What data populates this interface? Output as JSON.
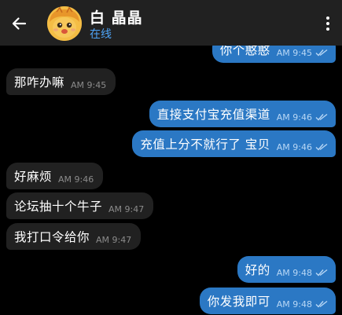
{
  "header": {
    "title": "白 晶晶",
    "status": "在线",
    "back_icon": "arrow-left-icon",
    "menu_icon": "more-vertical-icon",
    "status_color": "#4ea4f6"
  },
  "colors": {
    "incoming_bubble": "#212121",
    "outgoing_bubble": "#2b78c4",
    "background": "#000000"
  },
  "messages": [
    {
      "text": "你个憨憨",
      "time": "AM 9:45",
      "direction": "out",
      "read": true
    },
    {
      "text": "那咋办嘛",
      "time": "AM 9:45",
      "direction": "in"
    },
    {
      "text": "直接支付宝充值渠道",
      "time": "AM 9:46",
      "direction": "out",
      "read": true
    },
    {
      "text": "充值上分不就行了 宝贝",
      "time": "AM 9:46",
      "direction": "out",
      "read": true
    },
    {
      "text": "好麻烦",
      "time": "AM 9:46",
      "direction": "in"
    },
    {
      "text": "论坛抽十个牛子",
      "time": "AM 9:47",
      "direction": "in"
    },
    {
      "text": "我打口令给你",
      "time": "AM 9:47",
      "direction": "in"
    },
    {
      "text": "好的",
      "time": "AM 9:48",
      "direction": "out",
      "read": true
    },
    {
      "text": "你发我即可",
      "time": "AM 9:48",
      "direction": "out",
      "read": true
    }
  ]
}
